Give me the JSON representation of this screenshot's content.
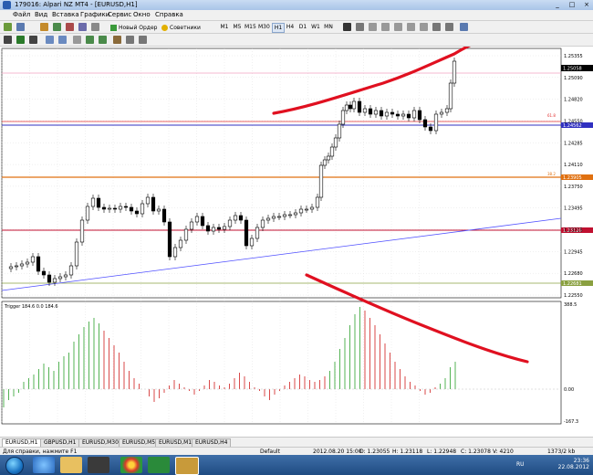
{
  "window": {
    "title": "179016: Alpari NZ MT4 - [EURUSD,H1]",
    "minimize": "_",
    "restore": "□",
    "close": "×"
  },
  "menu": [
    "Файл",
    "Вид",
    "Вставка",
    "Графики",
    "Сервис",
    "Окно",
    "Справка"
  ],
  "toolbar": {
    "new_order": "Новый Ордер",
    "advisors": "Советники",
    "timeframes": [
      "M1",
      "M5",
      "M15",
      "M30",
      "H1",
      "H4",
      "D1",
      "W1",
      "MN"
    ]
  },
  "chart": {
    "symbol": "EURUSD,H1",
    "price_labels": [
      "1.25355",
      "1.25090",
      "1.24820",
      "1.24550",
      "1.24285",
      "1.24110",
      "1.23750",
      "1.23495",
      "1.23215",
      "1.22945",
      "1.22680",
      "1.22550"
    ],
    "current_price": "1.25058",
    "level_labels": {
      "fib61": "61.8",
      "fib38": "38.2",
      "blue": "1.24562",
      "red": "1.23120",
      "green": "1.22681",
      "orange": "1.23905",
      "pink": "1.24958"
    },
    "x_labels": [
      "15 Aug 2012",
      "16 Aug 04:00",
      "16 Aug 12:00",
      "16 Aug 20:00",
      "17 Aug 04:00",
      "17 Aug 12:00",
      "17 Aug 20:00",
      "20 Aug 04:00",
      "20 Aug 12:00",
      "20 Aug 20:00",
      "21 Aug 04:00",
      "21 Aug 12:00",
      "21 Aug 20:00",
      "22 Aug 04:00",
      "22 Aug 12:00",
      "22 Aug 20:00"
    ],
    "indicator": {
      "label": "Trigger 184.6 0.0 184.6",
      "scale_labels": [
        "388.5",
        "0.00",
        "-167.3"
      ]
    }
  },
  "tabs": [
    "EURUSD,H1",
    "GBPUSD,H1",
    "EURUSD,M30",
    "EURUSD,M5",
    "EURUSD,M1",
    "EURUSD,H4"
  ],
  "status": {
    "help": "Для справки, нажмите F1",
    "profile": "Default",
    "datetime": "2012.08.20 15:00",
    "open": "O: 1.23055",
    "high": "H: 1.23118",
    "low": "L: 1.22948",
    "close": "C: 1.23078",
    "volume": "V: 4210",
    "traffic": "1373/2 kb"
  },
  "taskbar": {
    "lang": "RU",
    "time": "23:36",
    "date": "22.08.2012"
  },
  "colors": {
    "bull": "#2aa02a",
    "bear": "#d01c1c",
    "annotation": "#e01020",
    "trend": "#5050ff"
  }
}
